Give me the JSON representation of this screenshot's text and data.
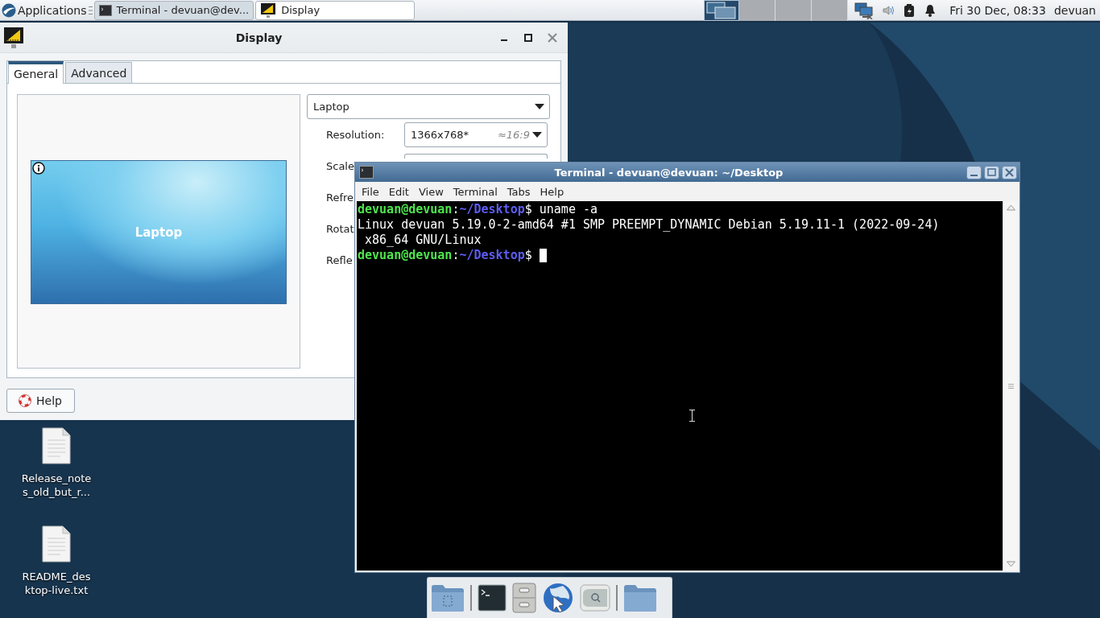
{
  "top_panel": {
    "menu_label": "Applications",
    "tasks": [
      {
        "label": "Terminal - devuan@dev...",
        "kind": "terminal",
        "selected": true
      },
      {
        "label": "Display",
        "kind": "display",
        "selected": false
      }
    ],
    "workspaces": [
      {
        "selected": true
      },
      {
        "selected": false
      },
      {
        "selected": false
      },
      {
        "selected": false
      }
    ],
    "clock": "Fri 30 Dec, 08:33",
    "user": "devuan"
  },
  "display_window": {
    "title": "Display",
    "tabs": [
      {
        "label": "General",
        "selected": true
      },
      {
        "label": "Advanced",
        "selected": false
      }
    ],
    "preview": {
      "monitor_label": "Laptop"
    },
    "output": "Laptop",
    "settings": [
      {
        "kind": "combo",
        "label": "Resolution:",
        "value": "1366x768*",
        "hint": "≈16:9"
      },
      {
        "kind": "combo",
        "label": "Scale"
      },
      {
        "kind": "label",
        "label": "Refre"
      },
      {
        "kind": "label",
        "label": "Rotat"
      },
      {
        "kind": "label",
        "label": "Refle"
      }
    ],
    "help_button": "Help"
  },
  "terminal_window": {
    "title": "Terminal - devuan@devuan: ~/Desktop",
    "menu": [
      "File",
      "Edit",
      "View",
      "Terminal",
      "Tabs",
      "Help"
    ],
    "lines": [
      {
        "cursor": false,
        "segments": [
          {
            "kind": "user",
            "text": "devuan@devuan"
          },
          {
            "kind": "plain",
            "text": ":"
          },
          {
            "kind": "path",
            "text": "~/Desktop"
          },
          {
            "kind": "plain",
            "text": "$ uname -a"
          }
        ]
      },
      {
        "cursor": false,
        "segments": [
          {
            "kind": "plain",
            "text": "Linux devuan 5.19.0-2-amd64 #1 SMP PREEMPT_DYNAMIC Debian 5.19.11-1 (2022-09-24)"
          }
        ]
      },
      {
        "cursor": false,
        "segments": [
          {
            "kind": "plain",
            "text": " x86_64 GNU/Linux"
          }
        ]
      },
      {
        "cursor": true,
        "segments": [
          {
            "kind": "user",
            "text": "devuan@devuan"
          },
          {
            "kind": "plain",
            "text": ":"
          },
          {
            "kind": "path",
            "text": "~/Desktop"
          },
          {
            "kind": "plain",
            "text": "$ "
          }
        ]
      }
    ]
  },
  "desktop_icons": [
    {
      "label": "Release_notes_old_but_r..."
    },
    {
      "label": "README_desktop-live.txt"
    }
  ]
}
